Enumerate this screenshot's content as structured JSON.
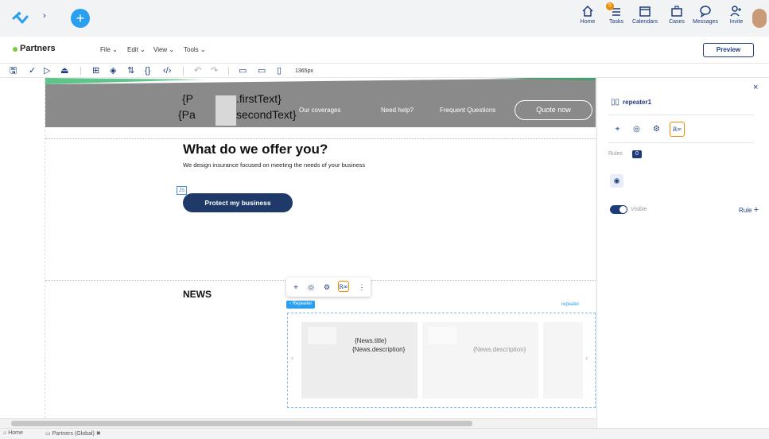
{
  "topbar": {
    "icons": [
      {
        "name": "home-icon",
        "label": "Home"
      },
      {
        "name": "tasks-icon",
        "label": "Tasks",
        "badge": "5"
      },
      {
        "name": "calendars-icon",
        "label": "Calendars"
      },
      {
        "name": "cases-icon",
        "label": "Cases"
      },
      {
        "name": "messages-icon",
        "label": "Messages"
      },
      {
        "name": "invite-icon",
        "label": "Invite"
      }
    ]
  },
  "header": {
    "title": "Partners",
    "menus": [
      "File",
      "Edit",
      "View",
      "Tools"
    ],
    "preview_label": "Preview"
  },
  "toolbar": {
    "width_label": "1365px"
  },
  "canvas": {
    "hero": {
      "text1": "{P",
      "text1b": ".firstText}",
      "text2": "{Pa",
      "text2b": "secondText}",
      "nav": [
        "Our coverages",
        "Need help?",
        "Frequent Questions"
      ],
      "quote_label": "Quote now"
    },
    "offer": {
      "heading": "What do we offer you?",
      "sub": "We design insurance focused on meeting the needs of your business",
      "js_badge": "Js",
      "button": "Protect my business"
    },
    "news": {
      "heading": "NEWS",
      "repeater_tag": "‹ Repeater",
      "repeater_name": "repeater",
      "card1_title": "{News.title}",
      "card1_desc": "{News.description}",
      "card2_desc": "{News.description}"
    }
  },
  "panel": {
    "close": "×",
    "component": "repeater1",
    "rules_label": "Rules",
    "rules_count": "0",
    "visible_label": "Visible",
    "rule_label": "Rule"
  },
  "bottom": {
    "home": "Home",
    "tab": "Partners (Global)",
    "tab_close": "✖"
  },
  "colors": {
    "accent": "#1c3d7a",
    "orange": "#f08a00",
    "navy": "#1f3a68",
    "gray_banner": "#8a8a8a"
  }
}
